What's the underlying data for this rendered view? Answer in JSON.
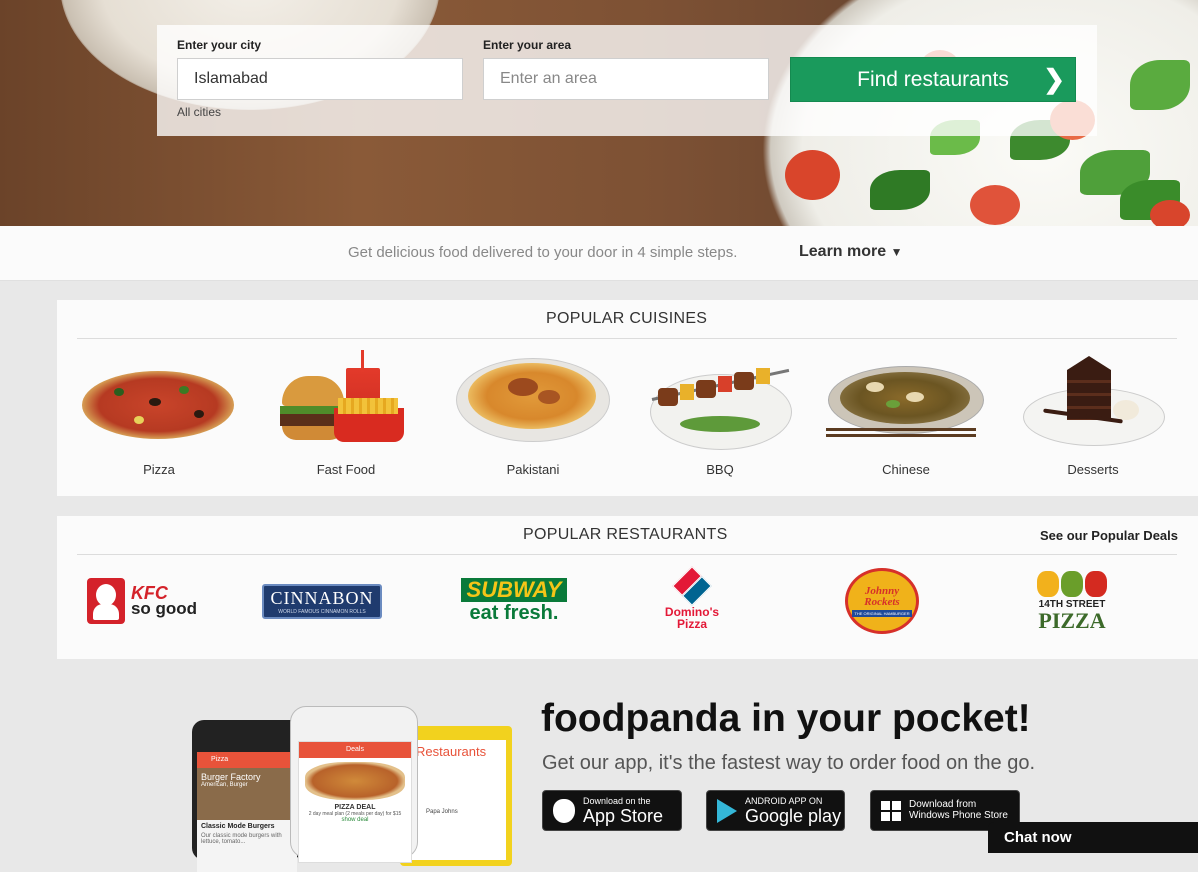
{
  "search": {
    "city_label": "Enter your city",
    "city_value": "Islamabad",
    "all_cities": "All cities",
    "area_label": "Enter your area",
    "area_placeholder": "Enter an area",
    "find_button": "Find restaurants",
    "find_icon": "chevron-right-icon"
  },
  "steps": {
    "text": "Get delicious food delivered to your door in 4 simple steps.",
    "learn_more": "Learn more",
    "learn_more_icon": "caret-down-icon"
  },
  "cuisines": {
    "title": "POPULAR CUISINES",
    "items": [
      {
        "label": "Pizza"
      },
      {
        "label": "Fast Food"
      },
      {
        "label": "Pakistani"
      },
      {
        "label": "BBQ"
      },
      {
        "label": "Chinese"
      },
      {
        "label": "Desserts"
      }
    ]
  },
  "restaurants": {
    "title": "POPULAR RESTAURANTS",
    "deals_link": "See our Popular Deals",
    "logos": [
      {
        "name": "kfc",
        "line1": "KFC",
        "line2": "so good"
      },
      {
        "name": "cinnabon",
        "line1": "CINNABON",
        "line2": "WORLD FAMOUS CINNAMON ROLLS"
      },
      {
        "name": "subway",
        "line1": "SUBWAY",
        "line2": "eat fresh."
      },
      {
        "name": "dominos",
        "line1": "Domino's",
        "line2": "Pizza"
      },
      {
        "name": "johnny-rockets",
        "line1": "Johnny Rockets",
        "line2": "THE ORIGINAL HAMBURGER"
      },
      {
        "name": "14th-street-pizza",
        "line1": "14TH STREET",
        "line2": "PIZZA"
      }
    ]
  },
  "app": {
    "title": "foodpanda in your pocket!",
    "subtitle": "Get our app, it's the fastest way to order food on the go.",
    "phone_screens": {
      "left_header": "Pizza",
      "left_item1": "Burger Factory",
      "left_item1_sub": "American, Burger",
      "left_item2": "Classic Mode Burgers",
      "left_item2_sub": "Our classic mode burgers with lettuce, tomato...",
      "center_header": "Deals",
      "center_deal": "PIZZA DEAL",
      "center_deal_sub": "2 day meal plan (2 meals per day) for $15",
      "center_link": "show deal",
      "right_header": "Restaurants",
      "right_item": "Papa Johns"
    },
    "stores": [
      {
        "small": "Download on the",
        "big": "App Store",
        "icon": "apple-icon"
      },
      {
        "small": "ANDROID APP ON",
        "big": "Google play",
        "icon": "google-play-icon"
      },
      {
        "small": "Download from",
        "big": "Windows Phone Store",
        "icon": "windows-icon"
      }
    ]
  },
  "chat": {
    "label": "Chat now"
  },
  "colors": {
    "accent_green": "#1a9a5c",
    "panel_bg": "#fbfbfb",
    "page_bg": "#e8e8e8"
  }
}
